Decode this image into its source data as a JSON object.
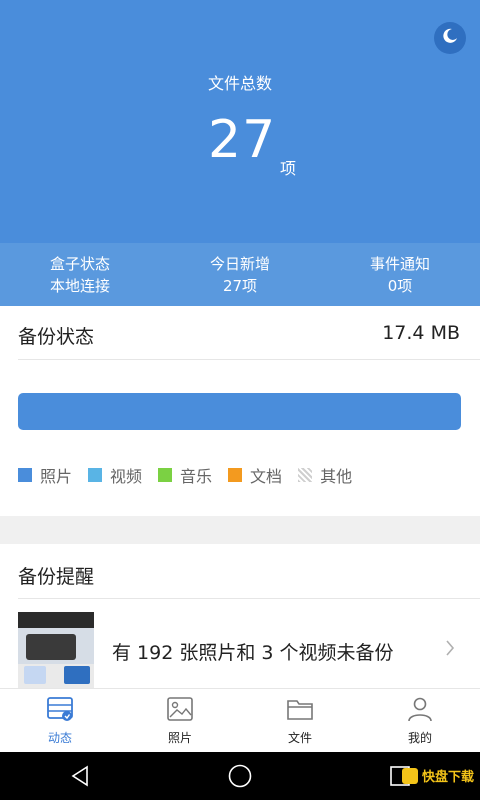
{
  "header": {
    "total_label": "文件总数",
    "total_count": "27",
    "total_unit": "项",
    "stats": [
      {
        "label": "盒子状态",
        "value": "本地连接"
      },
      {
        "label": "今日新增",
        "value": "27项"
      },
      {
        "label": "事件通知",
        "value": "0项"
      }
    ]
  },
  "backup_status": {
    "title": "备份状态",
    "size": "17.4 MB",
    "legend": [
      {
        "label": "照片",
        "color": "#4a8ddb"
      },
      {
        "label": "视频",
        "color": "#59b4e5"
      },
      {
        "label": "音乐",
        "color": "#7bd143"
      },
      {
        "label": "文档",
        "color": "#f39a1f"
      },
      {
        "label": "其他",
        "color": "hatched-gray"
      }
    ]
  },
  "reminder": {
    "title": "备份提醒",
    "text": "有 192 张照片和  3 个视频未备份"
  },
  "tabs": [
    {
      "label": "动态",
      "icon": "dynamic-icon",
      "active": true
    },
    {
      "label": "照片",
      "icon": "photo-icon",
      "active": false
    },
    {
      "label": "文件",
      "icon": "folder-icon",
      "active": false
    },
    {
      "label": "我的",
      "icon": "person-icon",
      "active": false
    }
  ],
  "watermark": {
    "text": "快盘下载"
  }
}
